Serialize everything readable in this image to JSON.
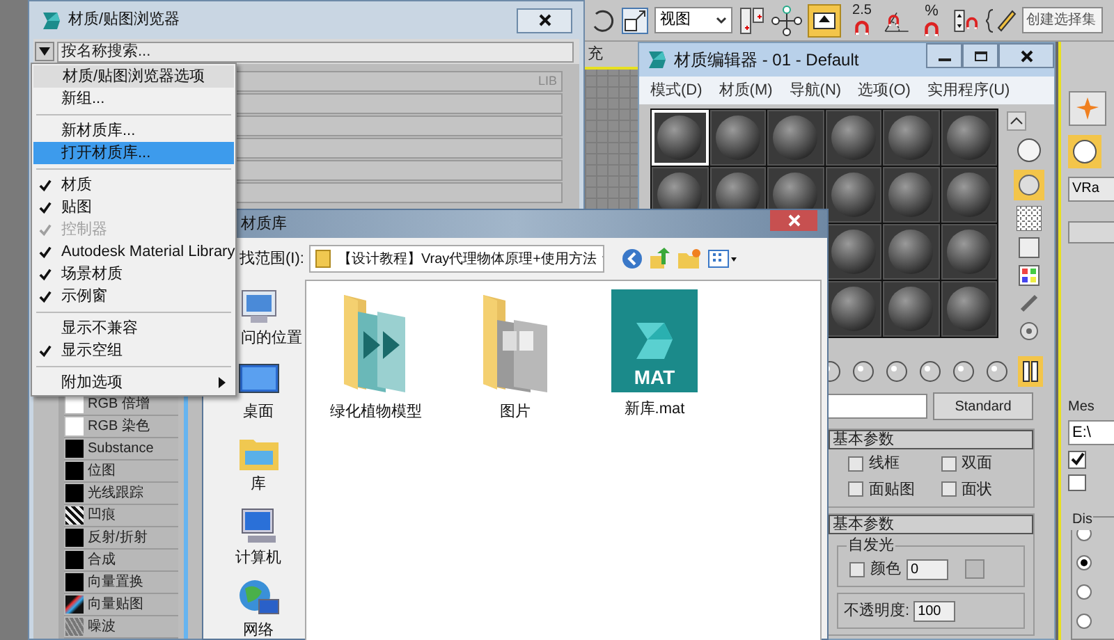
{
  "toolbar": {
    "view_dropdown": "视图",
    "snap_labels": [
      "2.5",
      "%"
    ],
    "selection_set_placeholder": "创建选择集"
  },
  "viewport": {
    "label": "充"
  },
  "material_browser": {
    "title": "材质/贴图浏览器",
    "search_placeholder": "按名称搜索...",
    "library_tag": "LIB",
    "maps": [
      {
        "label": "RGB 倍增",
        "kind": "white"
      },
      {
        "label": "RGB 染色",
        "kind": "white"
      },
      {
        "label": "Substance",
        "kind": "black"
      },
      {
        "label": "位图",
        "kind": "black"
      },
      {
        "label": "光线跟踪",
        "kind": "black"
      },
      {
        "label": "凹痕",
        "kind": "pattern"
      },
      {
        "label": "反射/折射",
        "kind": "black"
      },
      {
        "label": "合成",
        "kind": "black"
      },
      {
        "label": "向量置换",
        "kind": "black"
      },
      {
        "label": "向量贴图",
        "kind": "colorful"
      },
      {
        "label": "噪波",
        "kind": "noise"
      }
    ]
  },
  "options_menu": {
    "header": "材质/贴图浏览器选项",
    "items": [
      {
        "kind": "item",
        "label": "新组...",
        "selected": false
      },
      {
        "kind": "separator"
      },
      {
        "kind": "item",
        "label": "新材质库...",
        "selected": false
      },
      {
        "kind": "item",
        "label": "打开材质库...",
        "selected": true
      },
      {
        "kind": "separator"
      },
      {
        "kind": "check",
        "label": "材质",
        "checked": true,
        "disabled": false
      },
      {
        "kind": "check",
        "label": "贴图",
        "checked": true,
        "disabled": false
      },
      {
        "kind": "check",
        "label": "控制器",
        "checked": true,
        "disabled": true
      },
      {
        "kind": "check",
        "label": "Autodesk Material Library",
        "checked": true,
        "disabled": false
      },
      {
        "kind": "check",
        "label": "场景材质",
        "checked": true,
        "disabled": false
      },
      {
        "kind": "check",
        "label": "示例窗",
        "checked": true,
        "disabled": false
      },
      {
        "kind": "separator"
      },
      {
        "kind": "check",
        "label": "显示不兼容",
        "checked": false,
        "disabled": false
      },
      {
        "kind": "check",
        "label": "显示空组",
        "checked": true,
        "disabled": false
      },
      {
        "kind": "separator"
      },
      {
        "kind": "submenu",
        "label": "附加选项",
        "selected": false
      }
    ]
  },
  "material_editor": {
    "title": "材质编辑器 - 01 - Default",
    "menu": [
      "模式(D)",
      "材质(M)",
      "导航(N)",
      "选项(O)",
      "实用程序(U)"
    ],
    "slot_rows": [
      [
        {
          "selected": true
        },
        {
          "selected": false
        },
        {
          "selected": false
        },
        {
          "selected": false
        },
        {
          "selected": false
        },
        {
          "selected": false
        }
      ],
      [
        {
          "selected": false
        },
        {
          "selected": false
        },
        {
          "selected": false
        },
        {
          "selected": false
        },
        {
          "selected": false
        },
        {
          "selected": false
        }
      ],
      [
        {
          "selected": false
        },
        {
          "selected": false
        },
        {
          "selected": false
        }
      ],
      [
        {
          "selected": false
        },
        {
          "selected": false
        },
        {
          "selected": false
        }
      ]
    ],
    "type_button": "Standard",
    "shader_rollout": {
      "title": "基本参数",
      "options": [
        {
          "label": "线框",
          "checked": false
        },
        {
          "label": "双面",
          "checked": false
        },
        {
          "label": "面贴图",
          "checked": false
        },
        {
          "label": "面状",
          "checked": false
        }
      ]
    },
    "basic_rollout": {
      "title": "基本参数",
      "self_illum_group": "自发光",
      "color_option": {
        "label": "颜色",
        "checked": false
      },
      "color_value": "0",
      "opacity_label": "不透明度:",
      "opacity_value": "100"
    }
  },
  "command_panel": {
    "field_1": "VRa",
    "mesh_label": "Mes",
    "path_field": "E:\\",
    "options": [
      {
        "checked": true
      },
      {
        "checked": false
      }
    ],
    "group_label": "Dis",
    "radios": [
      {
        "selected": false
      },
      {
        "selected": true
      },
      {
        "selected": false
      },
      {
        "selected": false
      }
    ]
  },
  "open_dialog": {
    "title": "材质库",
    "look_in_label": "找范围(I):",
    "path": "【设计教程】Vray代理物体原理+使用方法",
    "places": [
      {
        "label": "问的位置",
        "kind": "recent"
      },
      {
        "label": "桌面",
        "kind": "desktop"
      },
      {
        "label": "库",
        "kind": "library"
      },
      {
        "label": "计算机",
        "kind": "computer"
      },
      {
        "label": "网络",
        "kind": "network"
      }
    ],
    "files": [
      {
        "name": "绿化植物模型",
        "kind": "app_folder"
      },
      {
        "name": "图片",
        "kind": "image_folder"
      },
      {
        "name": "新库.mat",
        "kind": "mat_file",
        "badge": "MAT"
      }
    ]
  }
}
